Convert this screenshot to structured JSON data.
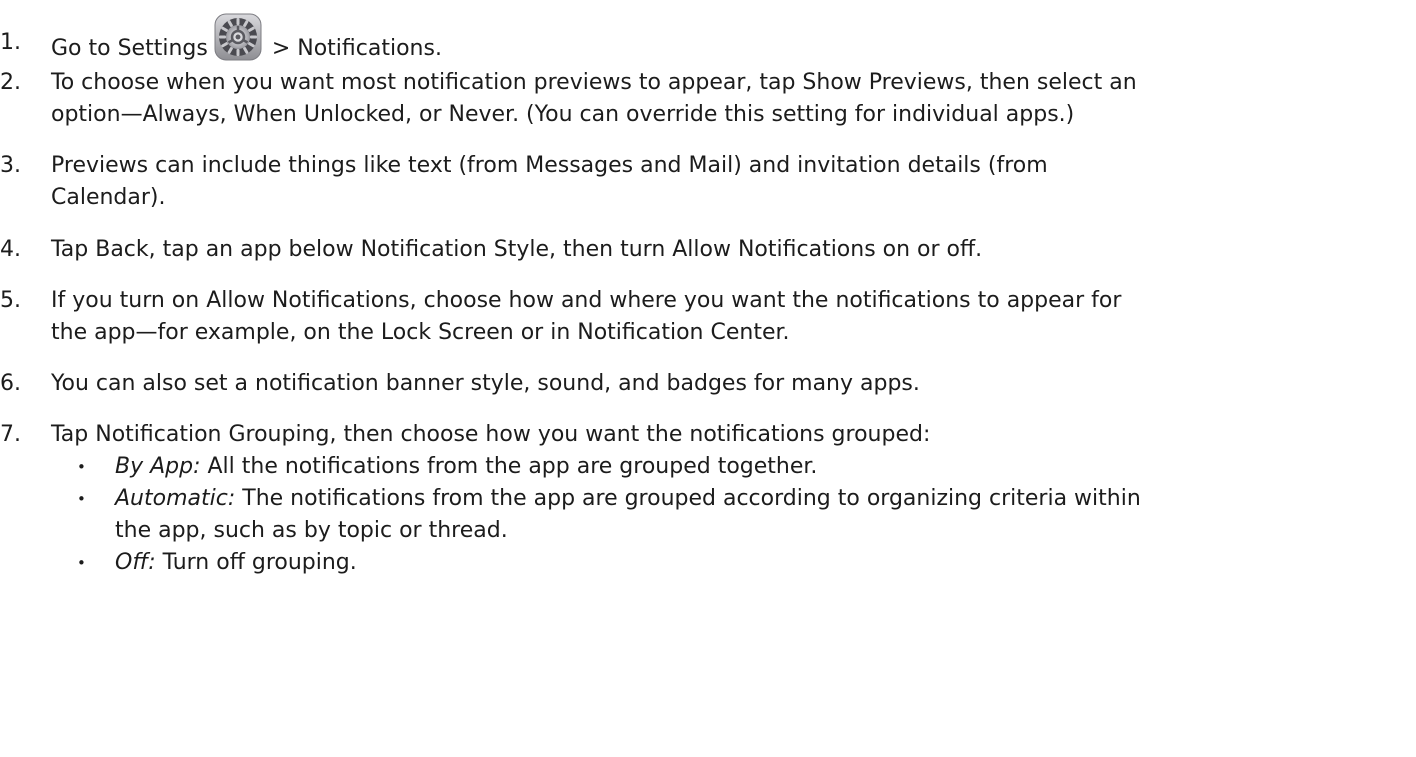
{
  "steps": [
    {
      "number": "1.",
      "before_icon": "Go to Settings",
      "icon": "settings-gear-icon",
      "after_icon": "> Notifications."
    },
    {
      "number": "2.",
      "lines": [
        "To choose when you want most notification previews to appear, tap Show Previews, then select an",
        "option—Always, When Unlocked, or Never. (You can override this setting for individual apps.)"
      ]
    },
    {
      "number": "3.",
      "lines": [
        "Previews can include things like text (from Messages and Mail) and invitation details (from",
        "Calendar)."
      ]
    },
    {
      "number": "4.",
      "lines": [
        "Tap Back, tap an app below Notification Style, then turn Allow Notifications on or off."
      ]
    },
    {
      "number": "5.",
      "lines": [
        "If you turn on Allow Notifications, choose how and where you want the notifications to appear for",
        "the app—for example, on the Lock Screen or in Notification Center."
      ]
    },
    {
      "number": "6.",
      "lines": [
        "You can also set a notification banner style, sound, and badges for many apps."
      ]
    },
    {
      "number": "7.",
      "lines": [
        "Tap Notification Grouping, then choose how you want the notifications grouped:"
      ]
    }
  ],
  "grouping_options": [
    {
      "bullet": "•",
      "term": "By App:",
      "lines": [
        "All the notifications from the app are grouped together."
      ]
    },
    {
      "bullet": "•",
      "term": "Automatic:",
      "lines": [
        "The notifications from the app are grouped according to organizing criteria within",
        "the app, such as by topic or thread."
      ]
    },
    {
      "bullet": "•",
      "term": "Off:",
      "lines": [
        "Turn off grouping."
      ]
    }
  ]
}
